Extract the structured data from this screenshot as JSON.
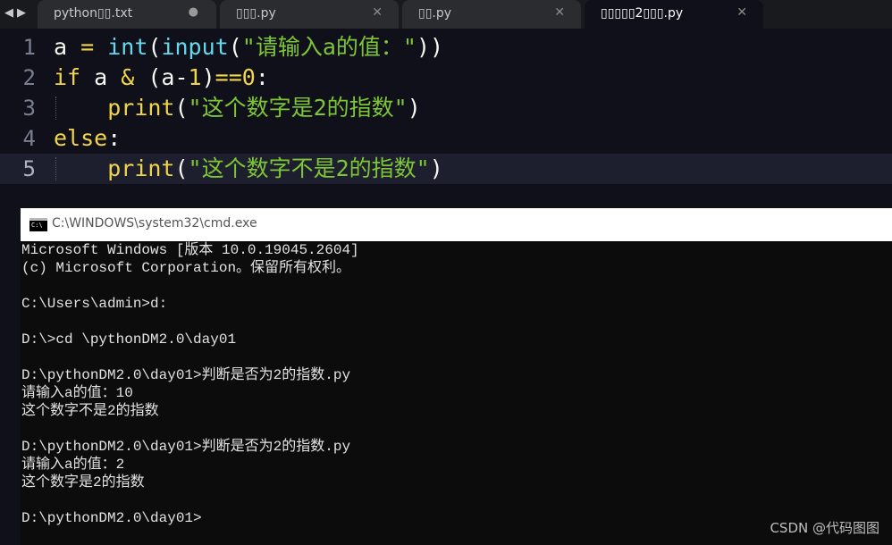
{
  "tabs": [
    {
      "label": "python▯▯.txt",
      "indicator": "●",
      "active": false
    },
    {
      "label": "▯▯▯.py",
      "indicator": "✕",
      "active": false
    },
    {
      "label": "▯▯.py",
      "indicator": "✕",
      "active": false
    },
    {
      "label": "▯▯▯▯▯2▯▯▯.py",
      "indicator": "✕",
      "active": true
    }
  ],
  "nav": {
    "left": "◀",
    "right": "▶"
  },
  "editor": {
    "line_numbers": [
      "1",
      "2",
      "3",
      "4",
      "5"
    ],
    "lines": [
      [
        {
          "t": "a "
        },
        {
          "t": "=",
          "c": "op"
        },
        {
          "t": " "
        },
        {
          "t": "int",
          "c": "fn"
        },
        {
          "t": "("
        },
        {
          "t": "input",
          "c": "fn"
        },
        {
          "t": "("
        },
        {
          "t": "\"请输入a的值：\"",
          "c": "str"
        },
        {
          "t": "))"
        }
      ],
      [
        {
          "t": "if",
          "c": "kw"
        },
        {
          "t": " a "
        },
        {
          "t": "&",
          "c": "op"
        },
        {
          "t": " (a-"
        },
        {
          "t": "1",
          "c": "num"
        },
        {
          "t": ")"
        },
        {
          "t": "==",
          "c": "op"
        },
        {
          "t": "0",
          "c": "num"
        },
        {
          "t": ":"
        }
      ],
      [
        {
          "t": "    "
        },
        {
          "t": "print",
          "c": "kw"
        },
        {
          "t": "("
        },
        {
          "t": "\"这个数字是2的指数\"",
          "c": "str"
        },
        {
          "t": ")"
        }
      ],
      [
        {
          "t": "else",
          "c": "kw"
        },
        {
          "t": ":"
        }
      ],
      [
        {
          "t": "    "
        },
        {
          "t": "print",
          "c": "kw"
        },
        {
          "t": "("
        },
        {
          "t": "\"这个数字不是2的指数\"",
          "c": "str"
        },
        {
          "t": ")"
        }
      ]
    ],
    "current_line": 5
  },
  "console": {
    "title": "C:\\WINDOWS\\system32\\cmd.exe",
    "icon_text": "C:\\",
    "lines": [
      "Microsoft Windows [版本 10.0.19045.2604]",
      "(c) Microsoft Corporation。保留所有权利。",
      "",
      "C:\\Users\\admin>d:",
      "",
      "D:\\>cd \\pythonDM2.0\\day01",
      "",
      "D:\\pythonDM2.0\\day01>判断是否为2的指数.py",
      "请输入a的值：10",
      "这个数字不是2的指数",
      "",
      "D:\\pythonDM2.0\\day01>判断是否为2的指数.py",
      "请输入a的值：2",
      "这个数字是2的指数",
      "",
      "D:\\pythonDM2.0\\day01>"
    ]
  },
  "watermark": "CSDN @代码图图"
}
